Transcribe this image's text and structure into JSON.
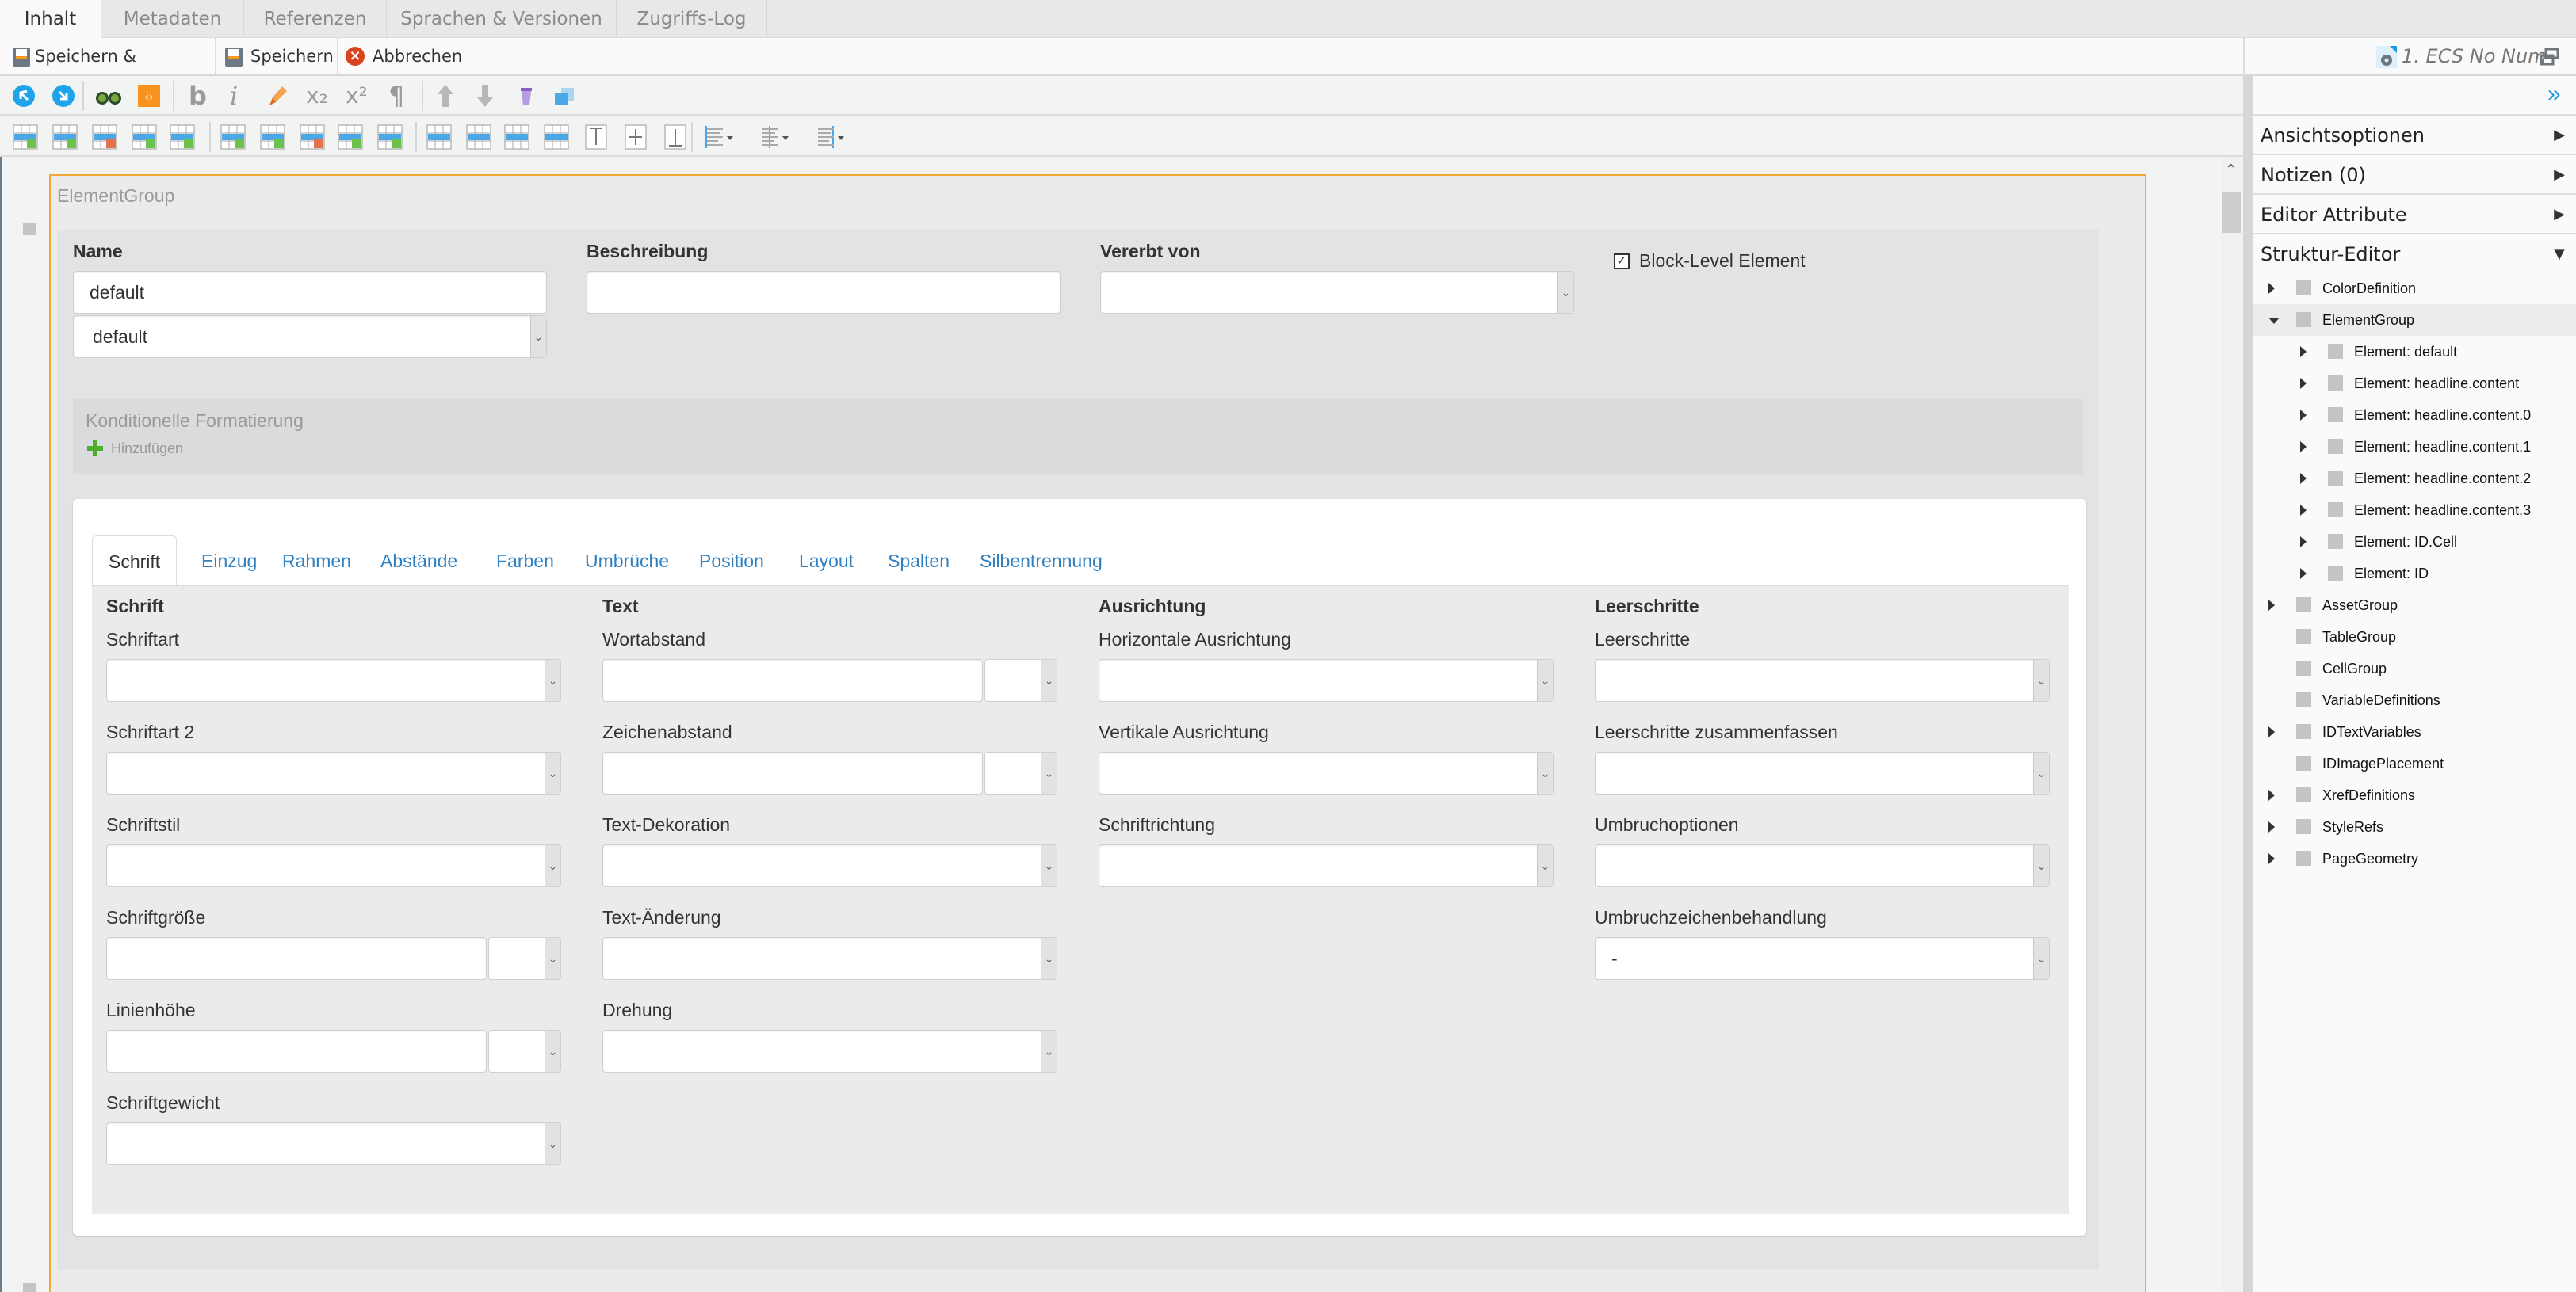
{
  "top_tabs": [
    {
      "label": "Inhalt",
      "active": true
    },
    {
      "label": "Metadaten",
      "active": false
    },
    {
      "label": "Referenzen",
      "active": false
    },
    {
      "label": "Sprachen & Versionen",
      "active": false
    },
    {
      "label": "Zugriffs-Log",
      "active": false
    }
  ],
  "actions": {
    "save_close": "Speichern & Schließen",
    "save": "Speichern",
    "cancel": "Abbrechen"
  },
  "document_badge": "1. ECS No Num",
  "toolbar1_icons": [
    "undo-icon",
    "redo-icon",
    "binoculars-icon",
    "source-code-icon",
    "bold-icon",
    "italic-icon",
    "highlighter-icon",
    "subscript-icon",
    "superscript-icon",
    "pilcrow-icon",
    "move-up-icon",
    "move-down-icon",
    "delete-bin-icon",
    "duplicate-icon"
  ],
  "toolbar1_glyphs": {
    "bold": "b",
    "italic": "i",
    "subscript": "x₂",
    "superscript": "x²",
    "pilcrow": "¶"
  },
  "toolbar2_icons": [
    "insert-row-above-icon",
    "insert-row-below-icon",
    "delete-row-icon",
    "move-row-up-icon",
    "move-row-down-icon",
    "insert-column-left-icon",
    "insert-column-right-icon",
    "delete-column-icon",
    "move-column-left-icon",
    "move-column-right-icon",
    "merge-row-icon",
    "merge-column-icon",
    "split-horizontal-icon",
    "split-vertical-icon",
    "valign-top-icon",
    "valign-middle-icon",
    "valign-bottom-icon",
    "align-left-dropdown-icon",
    "align-center-dropdown-icon",
    "align-right-dropdown-icon"
  ],
  "right_panel": {
    "sections": [
      {
        "label": "Ansichtsoptionen",
        "expanded": false
      },
      {
        "label": "Notizen (0)",
        "expanded": false
      },
      {
        "label": "Editor Attribute",
        "expanded": false
      },
      {
        "label": "Struktur-Editor",
        "expanded": true
      }
    ],
    "tree": [
      {
        "label": "ColorDefinition",
        "level": 0,
        "has_children": true,
        "expanded": false
      },
      {
        "label": "ElementGroup",
        "level": 0,
        "has_children": true,
        "expanded": true,
        "selected": true
      },
      {
        "label": "Element: default",
        "level": 1,
        "has_children": true
      },
      {
        "label": "Element: headline.content",
        "level": 1,
        "has_children": true
      },
      {
        "label": "Element: headline.content.0",
        "level": 1,
        "has_children": true
      },
      {
        "label": "Element: headline.content.1",
        "level": 1,
        "has_children": true
      },
      {
        "label": "Element: headline.content.2",
        "level": 1,
        "has_children": true
      },
      {
        "label": "Element: headline.content.3",
        "level": 1,
        "has_children": true
      },
      {
        "label": "Element: ID.Cell",
        "level": 1,
        "has_children": true
      },
      {
        "label": "Element: ID",
        "level": 1,
        "has_children": true
      },
      {
        "label": "AssetGroup",
        "level": 0,
        "has_children": true
      },
      {
        "label": "TableGroup",
        "level": 0,
        "has_children": false
      },
      {
        "label": "CellGroup",
        "level": 0,
        "has_children": false
      },
      {
        "label": "VariableDefinitions",
        "level": 0,
        "has_children": false
      },
      {
        "label": "IDTextVariables",
        "level": 0,
        "has_children": true
      },
      {
        "label": "IDImagePlacement",
        "level": 0,
        "has_children": false
      },
      {
        "label": "XrefDefinitions",
        "level": 0,
        "has_children": true
      },
      {
        "label": "StyleRefs",
        "level": 0,
        "has_children": true
      },
      {
        "label": "PageGeometry",
        "level": 0,
        "has_children": true
      }
    ]
  },
  "group": {
    "title": "ElementGroup",
    "name_label": "Name",
    "name_value": "default",
    "name_select_value": "default",
    "description_label": "Beschreibung",
    "description_value": "",
    "inherited_label": "Vererbt von",
    "inherited_value": "",
    "block_level_label": "Block-Level Element",
    "block_level_checked": true,
    "conditional_title": "Konditionelle Formatierung",
    "add_label": "Hinzufügen"
  },
  "style_tabs": [
    {
      "label": "Schrift",
      "active": true
    },
    {
      "label": "Einzug"
    },
    {
      "label": "Rahmen"
    },
    {
      "label": "Abstände"
    },
    {
      "label": "Farben"
    },
    {
      "label": "Umbrüche"
    },
    {
      "label": "Position"
    },
    {
      "label": "Layout"
    },
    {
      "label": "Spalten"
    },
    {
      "label": "Silbentrennung"
    }
  ],
  "columns": [
    {
      "heading": "Schrift",
      "fields": [
        {
          "label": "Schriftart",
          "type": "select",
          "value": ""
        },
        {
          "label": "Schriftart 2",
          "type": "select",
          "value": ""
        },
        {
          "label": "Schriftstil",
          "type": "select",
          "value": ""
        },
        {
          "label": "Schriftgröße",
          "type": "unit",
          "value": ""
        },
        {
          "label": "Linienhöhe",
          "type": "unit",
          "value": ""
        },
        {
          "label": "Schriftgewicht",
          "type": "select",
          "value": ""
        }
      ]
    },
    {
      "heading": "Text",
      "fields": [
        {
          "label": "Wortabstand",
          "type": "unit",
          "value": ""
        },
        {
          "label": "Zeichenabstand",
          "type": "unit",
          "value": ""
        },
        {
          "label": "Text-Dekoration",
          "type": "select",
          "value": ""
        },
        {
          "label": "Text-Änderung",
          "type": "select",
          "value": ""
        },
        {
          "label": "Drehung",
          "type": "select",
          "value": ""
        }
      ]
    },
    {
      "heading": "Ausrichtung",
      "fields": [
        {
          "label": "Horizontale Ausrichtung",
          "type": "select",
          "value": ""
        },
        {
          "label": "Vertikale Ausrichtung",
          "type": "select",
          "value": ""
        },
        {
          "label": "Schriftrichtung",
          "type": "select",
          "value": ""
        }
      ]
    },
    {
      "heading": "Leerschritte",
      "fields": [
        {
          "label": "Leerschritte",
          "type": "select",
          "value": ""
        },
        {
          "label": "Leerschritte zusammenfassen",
          "type": "select",
          "value": ""
        },
        {
          "label": "Umbruchoptionen",
          "type": "select",
          "value": ""
        },
        {
          "label": "Umbruchzeichenbehandlung",
          "type": "select",
          "value": "-"
        }
      ]
    }
  ],
  "colors": {
    "accent_blue": "#2f7fc1",
    "group_border": "#f2a833",
    "add_green": "#4cae2a",
    "cancel_red": "#d9431f"
  }
}
